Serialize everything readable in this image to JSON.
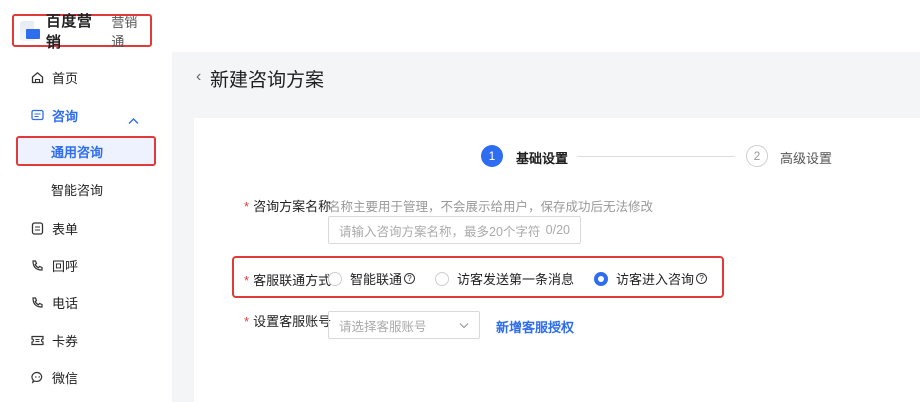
{
  "logo": {
    "brand": "百度营销",
    "product": "营销通"
  },
  "sidebar": {
    "items": [
      {
        "label": "首页",
        "icon": "home-icon"
      },
      {
        "label": "咨询",
        "icon": "chat-icon"
      },
      {
        "label": "表单",
        "icon": "form-icon"
      },
      {
        "label": "回呼",
        "icon": "callback-icon"
      },
      {
        "label": "电话",
        "icon": "phone-icon"
      },
      {
        "label": "卡券",
        "icon": "coupon-icon"
      },
      {
        "label": "微信",
        "icon": "wechat-icon"
      }
    ],
    "sub_items": [
      {
        "label": "通用咨询"
      },
      {
        "label": "智能咨询"
      }
    ]
  },
  "header": {
    "back_symbol": "‹",
    "title": "新建咨询方案"
  },
  "steps": [
    {
      "number": "1",
      "label": "基础设置"
    },
    {
      "number": "2",
      "label": "高级设置"
    }
  ],
  "form": {
    "name": {
      "label": "咨询方案名称",
      "hint": "名称主要用于管理，不会展示给用户，保存成功后无法修改",
      "placeholder": "请输入咨询方案名称，最多20个字符",
      "counter": "0/20"
    },
    "contact_method": {
      "label": "客服联通方式",
      "options": [
        "智能联通",
        "访客发送第一条消息",
        "访客进入咨询"
      ],
      "selected": "访客进入咨询"
    },
    "account": {
      "label": "设置客服账号",
      "placeholder": "请选择客服账号",
      "link": "新增客服授权"
    }
  },
  "colors": {
    "accent": "#2f6df0",
    "highlight": "#e03a3a",
    "required": "#e03a3a"
  }
}
